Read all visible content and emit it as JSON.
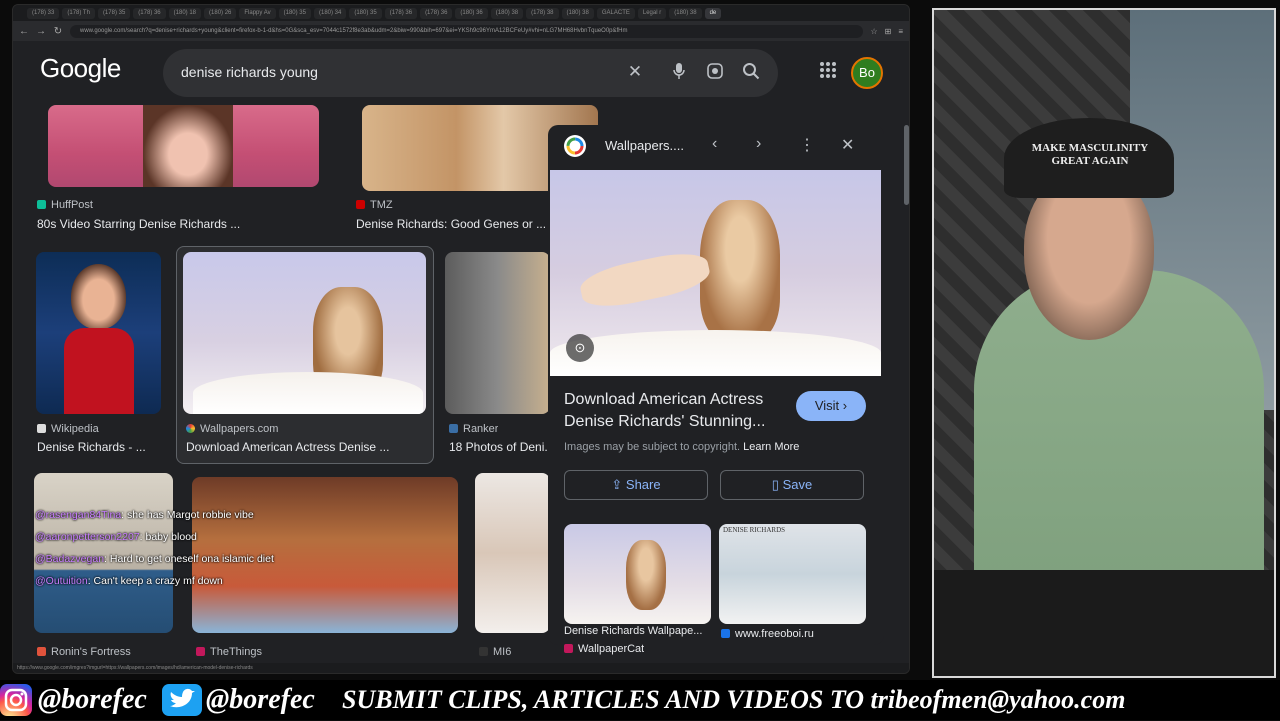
{
  "browser": {
    "tabs": [
      "(178) 33",
      "(178) Th",
      "(178) 35",
      "(178) 36",
      "(180) 18",
      "(180) 26",
      "Flappy Av",
      "(180) 35",
      "(180) 34",
      "(180) 35",
      "(178) 36",
      "(178) 36",
      "(180) 36",
      "(180) 38",
      "(178) 38",
      "(180) 38",
      "GALACTE",
      "Legal r",
      "(180) 38",
      "de"
    ],
    "address": "www.google.com/search?q=denise+richards+young&client=firefox-b-1-d&hs=0G&sca_esv=7044c1572f8e3ab&udm=2&biw=990&bih=697&ei=YKSh9c96YmA12BCFeUy#vhi=nLG7MH68HvbnTqueO0p&fHm"
  },
  "google": {
    "logo": "Google",
    "query": "denise richards young",
    "avatar": "Bo"
  },
  "results": [
    {
      "source": "HuffPost",
      "title": "80s Video Starring Denise Richards ..."
    },
    {
      "source": "TMZ",
      "title": "Denise Richards: Good Genes or ..."
    },
    {
      "source": "Wikipedia",
      "title": "Denise Richards - ..."
    },
    {
      "source": "Wallpapers.com",
      "title": "Download American Actress Denise ..."
    },
    {
      "source": "Ranker",
      "title": "18 Photos of Deni..."
    },
    {
      "source": "Ronin's Fortress",
      "title": ""
    },
    {
      "source": "TheThings",
      "title": ""
    },
    {
      "source": "MI6",
      "title": ""
    }
  ],
  "panel": {
    "site": "Wallpapers....",
    "title": "Download American Actress Denise Richards' Stunning...",
    "visit": "Visit",
    "copyright": "Images may be subject to copyright.",
    "learn_more": "Learn More",
    "share": "Share",
    "save": "Save",
    "related": [
      {
        "source": "WallpaperCat",
        "title": "Denise Richards Wallpape..."
      },
      {
        "source": "www.freeoboi.ru",
        "title": ""
      }
    ],
    "related_caption": "DENISE RICHARDS"
  },
  "chat": [
    {
      "user": "@rasengan84Tina",
      "msg": ": she has Margot robbie vibe"
    },
    {
      "user": "@aaronpetterson2207",
      "msg": ": baby blood"
    },
    {
      "user": "@Badazvegan",
      "msg": ": Hard to get oneself ona islamic diet"
    },
    {
      "user": "@Outuition",
      "msg": ": Can't keep a crazy mf down"
    }
  ],
  "webcam": {
    "hat_text": "MAKE MASCULINITY GREAT AGAIN"
  },
  "banner": {
    "instagram": "@borefec",
    "twitter": "@borefec",
    "cta": "SUBMIT CLIPS, ARTICLES AND VIDEOS TO tribeofmen@yahoo.com"
  },
  "status_bar": "https://www.google.com/imgres?imgurl=https://wallpapers.com/images/hd/american-model-denise-richards"
}
